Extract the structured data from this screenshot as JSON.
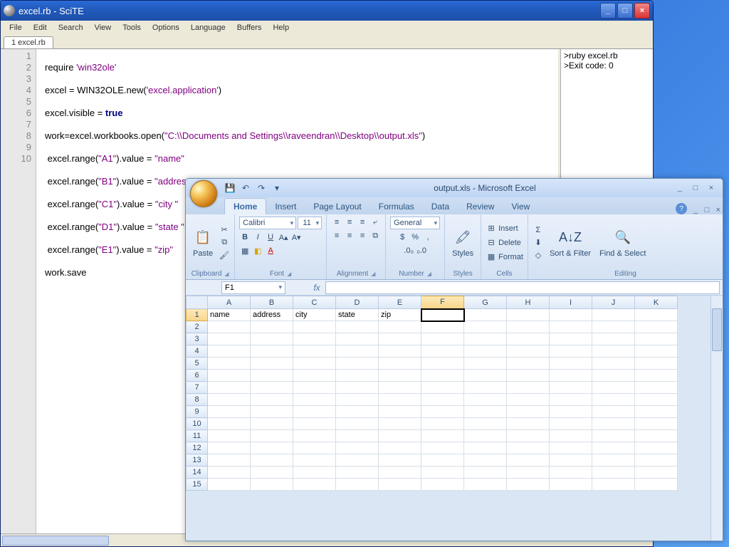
{
  "scite": {
    "title": "excel.rb - SciTE",
    "menu": [
      "File",
      "Edit",
      "Search",
      "View",
      "Tools",
      "Options",
      "Language",
      "Buffers",
      "Help"
    ],
    "tab_label": "1 excel.rb",
    "line_numbers": [
      "1",
      "2",
      "3",
      "4",
      "5",
      "6",
      "7",
      "8",
      "9",
      "10"
    ],
    "code": {
      "l1_a": "require ",
      "l1_s": "'win32ole'",
      "l2_a": "excel = WIN32OLE.new(",
      "l2_s": "'excel.application'",
      "l2_b": ")",
      "l3_a": "excel.visible = ",
      "l3_k": "true",
      "l4_a": "work=excel.workbooks.open(",
      "l4_s": "\"C:\\\\Documents and Settings\\\\raveendran\\\\Desktop\\\\output.xls\"",
      "l4_b": ")",
      "l5_a": " excel.range(",
      "l5_s": "\"A1\"",
      "l5_b": ").value = ",
      "l5_s2": "\"name\"",
      "l6_a": " excel.range(",
      "l6_s": "\"B1\"",
      "l6_b": ").value = ",
      "l6_s2": "\"address\"",
      "l7_a": " excel.range(",
      "l7_s": "\"C1\"",
      "l7_b": ").value = ",
      "l7_s2": "\"city \"",
      "l8_a": " excel.range(",
      "l8_s": "\"D1\"",
      "l8_b": ").value = ",
      "l8_s2": "\"state \"",
      "l9_a": " excel.range(",
      "l9_s": "\"E1\"",
      "l9_b": ").value = ",
      "l9_s2": "\"zip\"",
      "l10": "work.save"
    },
    "output": {
      "line1": ">ruby excel.rb",
      "line2": ">Exit code: 0"
    }
  },
  "excel": {
    "title": "output.xls - Microsoft Excel",
    "ribbon_tabs": [
      "Home",
      "Insert",
      "Page Layout",
      "Formulas",
      "Data",
      "Review",
      "View"
    ],
    "active_tab": "Home",
    "font_name": "Calibri",
    "font_size": "11",
    "number_format": "General",
    "groups": {
      "clipboard": "Clipboard",
      "font": "Font",
      "alignment": "Alignment",
      "number": "Number",
      "styles": "Styles",
      "cells": "Cells",
      "editing": "Editing"
    },
    "buttons": {
      "paste": "Paste",
      "styles": "Styles",
      "insert": "Insert",
      "delete": "Delete",
      "format": "Format",
      "sort_filter": "Sort & Filter",
      "find_select": "Find & Select"
    },
    "symbols": {
      "currency": "$",
      "percent": "%",
      "comma": ",",
      "inc_dec1": ".0₀",
      "inc_dec2": "₀.0"
    },
    "icons": {
      "save": "💾",
      "undo": "↶",
      "redo": "↷",
      "down": "▾",
      "cut": "✂",
      "copy": "⧉",
      "brush": "🖌",
      "bold": "B",
      "italic": "I",
      "underline": "U",
      "border": "▦",
      "fill": "◧",
      "fontcolor": "A",
      "grow": "A▴",
      "shrink": "A▾",
      "al": "≡",
      "ac": "≡",
      "ar": "≡",
      "wrap": "⤶",
      "merge": "⧉",
      "sigma": "Σ",
      "downfill": "⬇",
      "clear": "◇",
      "sort": "A↓Z",
      "find": "🔍",
      "paste": "📋",
      "styles": "🖍",
      "ins": "⊞",
      "del": "⊟",
      "fmt": "▦"
    },
    "namebox": "F1",
    "fx_label": "fx",
    "help": "?",
    "columns": [
      "A",
      "B",
      "C",
      "D",
      "E",
      "F",
      "G",
      "H",
      "I",
      "J",
      "K"
    ],
    "rows": [
      "1",
      "2",
      "3",
      "4",
      "5",
      "6",
      "7",
      "8",
      "9",
      "10",
      "11",
      "12",
      "13",
      "14",
      "15"
    ],
    "cells": {
      "A1": "name",
      "B1": "address",
      "C1": "city",
      "D1": "state",
      "E1": "zip"
    },
    "active_col": "F",
    "active_row": "1",
    "active_cell": "F1"
  }
}
